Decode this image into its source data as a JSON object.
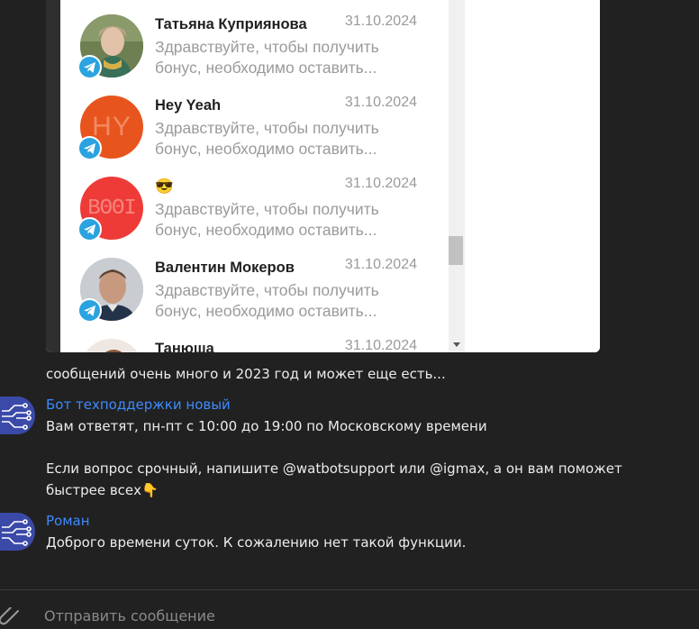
{
  "screenshot": {
    "chats": [
      {
        "name": "Татьяна Куприянова",
        "date": "31.10.2024",
        "preview": "Здравствуйте, чтобы получить бонус, необходимо оставить..."
      },
      {
        "name": "Hey Yeah",
        "date": "31.10.2024",
        "preview": "Здравствуйте, чтобы получить бонус, необходимо оставить...",
        "avatar_text": "HY"
      },
      {
        "name": "😎",
        "date": "31.10.2024",
        "preview": "Здравствуйте, чтобы получить бонус, необходимо оставить...",
        "avatar_text": "ΒΘΘΙ"
      },
      {
        "name": "Валентин Мокеров",
        "date": "31.10.2024",
        "preview": "Здравствуйте, чтобы получить бонус, необходимо оставить..."
      },
      {
        "name": "Танюша",
        "date": "31.10.2024",
        "preview": ""
      }
    ]
  },
  "messages": {
    "m1_text": "сообщений очень много и 2023 год и может еще есть...",
    "m2_author": "Бот техподдержки новый",
    "m2_line1": "Вам ответят, пн-пт с 10:00 до 19:00 по Московскому времени",
    "m2_line2": "Если вопрос срочный, напишите @watbotsupport или @igmax, а он вам поможет",
    "m2_line3": "быстрее всех👇",
    "m3_author": "Роман",
    "m3_text": "Доброго времени суток. К сожалению нет такой функции."
  },
  "composer": {
    "placeholder": "Отправить сообщение"
  },
  "colors": {
    "background": "#212121",
    "author": "#3d8bff",
    "telegram": "#2aa3e0"
  }
}
